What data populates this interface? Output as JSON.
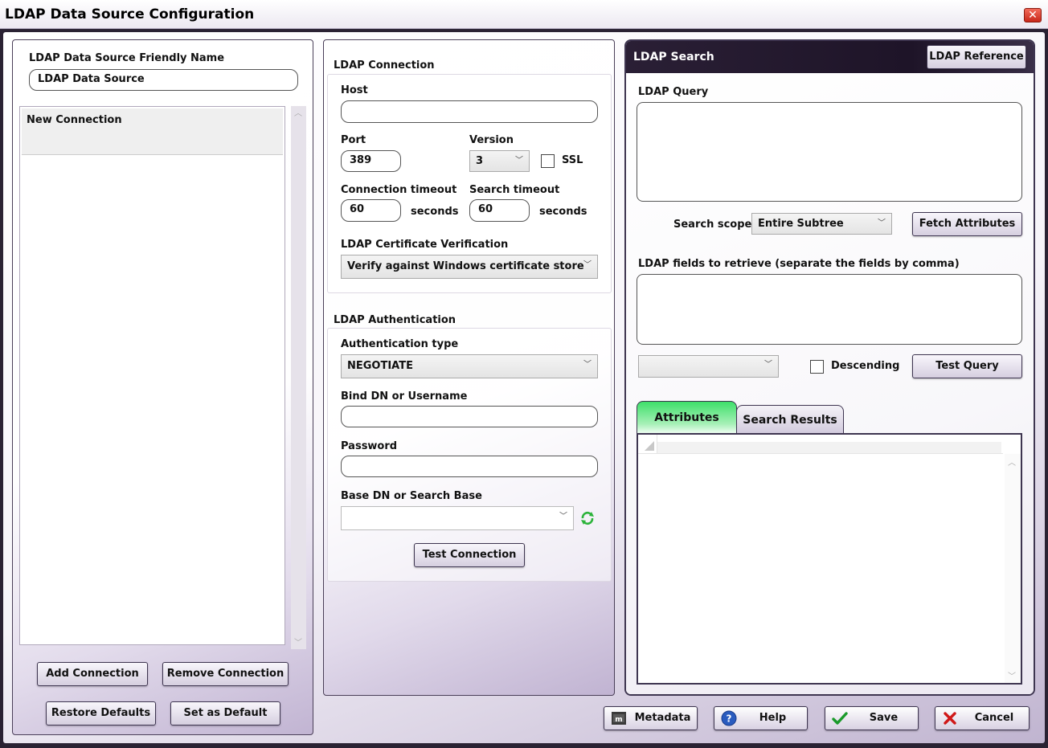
{
  "window": {
    "title": "LDAP Data Source Configuration",
    "close_glyph": "✕"
  },
  "left": {
    "friendly_name_label": "LDAP Data Source Friendly Name",
    "friendly_name_value": "LDAP Data Source",
    "connections": [
      {
        "label": "New Connection"
      }
    ],
    "add_label": "Add Connection",
    "remove_label": "Remove Connection",
    "restore_label": "Restore Defaults",
    "set_default_label": "Set as Default"
  },
  "connection": {
    "section_title": "LDAP Connection",
    "host_label": "Host",
    "host_value": "",
    "port_label": "Port",
    "port_value": "389",
    "version_label": "Version",
    "version_value": "3",
    "ssl_label": "SSL",
    "conn_timeout_label": "Connection timeout",
    "conn_timeout_value": "60",
    "seconds_label": "seconds",
    "search_timeout_label": "Search timeout",
    "search_timeout_value": "60",
    "cert_label": "LDAP Certificate Verification",
    "cert_value": "Verify against Windows certificate store"
  },
  "auth": {
    "section_title": "LDAP Authentication",
    "type_label": "Authentication type",
    "type_value": "NEGOTIATE",
    "bind_label": "Bind DN or Username",
    "bind_value": "",
    "password_label": "Password",
    "password_value": "",
    "base_label": "Base DN or Search Base",
    "base_value": "",
    "test_label": "Test Connection"
  },
  "search": {
    "header_title": "LDAP Search",
    "reference_label": "LDAP Reference",
    "query_label": "LDAP Query",
    "scope_label": "Search scope",
    "scope_value": "Entire Subtree",
    "fetch_label": "Fetch Attributes",
    "fields_label": "LDAP fields to retrieve (separate the fields by comma)",
    "sort_value": "",
    "descending_label": "Descending",
    "test_query_label": "Test Query",
    "tabs": [
      {
        "label": "Attributes",
        "active": true
      },
      {
        "label": "Search Results",
        "active": false
      }
    ]
  },
  "footer": {
    "metadata_label": "Metadata",
    "help_label": "Help",
    "save_label": "Save",
    "cancel_label": "Cancel"
  },
  "colors": {
    "accent_tab": "#3ee06a",
    "header_dark": "#1e1428",
    "save_icon": "#1a9a2a",
    "cancel_icon": "#d01818",
    "help_icon": "#2a5cbf"
  }
}
